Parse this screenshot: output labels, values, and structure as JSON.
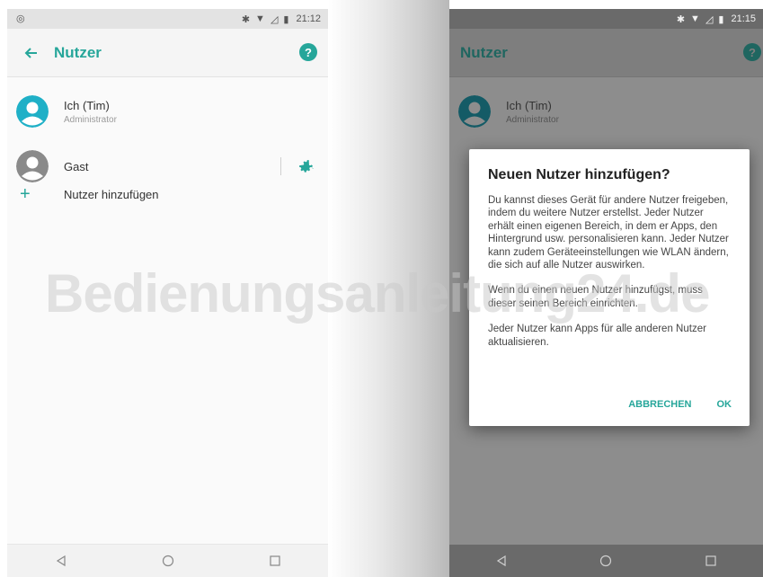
{
  "left_screen": {
    "status": {
      "time": "21:12"
    },
    "toolbar": {
      "back_icon": "arrow-left-icon",
      "title": "Nutzer",
      "help_icon": "help-circle-icon"
    },
    "users": [
      {
        "name": "Ich (Tim)",
        "role": "Administrator"
      },
      {
        "name": "Gast"
      }
    ],
    "add_user_label": "Nutzer hinzufügen"
  },
  "right_screen": {
    "status": {
      "time": "21:15"
    },
    "toolbar": {
      "title": "Nutzer"
    },
    "users": [
      {
        "name": "Ich (Tim)",
        "role": "Administrator"
      }
    ],
    "dialog": {
      "title": "Neuen Nutzer hinzufügen?",
      "paragraphs": [
        "Du kannst dieses Gerät für andere Nutzer freigeben, indem du weitere Nutzer erstellst. Jeder Nutzer erhält einen eigenen Bereich, in dem er Apps, den Hintergrund usw. personalisieren kann. Jeder Nutzer kann zudem Geräteeinstellungen wie WLAN ändern, die sich auf alle Nutzer auswirken.",
        "Wenn du einen neuen Nutzer hinzufügst, muss dieser seinen Bereich einrichten.",
        "Jeder Nutzer kann Apps für alle anderen Nutzer aktualisieren."
      ],
      "cancel_label": "ABBRECHEN",
      "ok_label": "OK"
    }
  },
  "watermark": "Bedienungsanleitung24.de",
  "colors": {
    "accent": "#26a69a",
    "accent_dark": "#1f6660",
    "admin_avatar": "#1fb0c7",
    "guest_avatar": "#8a8a8a"
  }
}
